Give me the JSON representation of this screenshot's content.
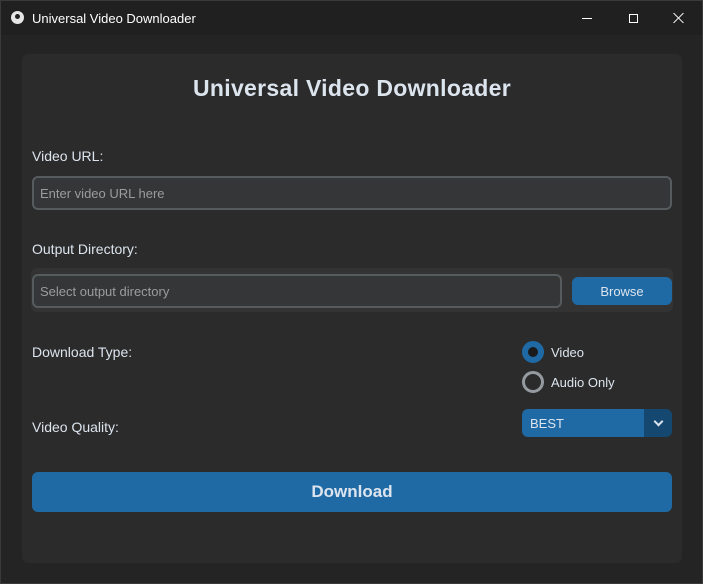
{
  "window": {
    "title": "Universal Video Downloader",
    "controls": [
      "minimize",
      "maximize",
      "close"
    ]
  },
  "main": {
    "heading": "Universal Video Downloader",
    "url": {
      "label": "Video URL:",
      "value": "",
      "placeholder": "Enter video URL here"
    },
    "output": {
      "label": "Output Directory:",
      "value": "",
      "placeholder": "Select output directory",
      "browse_label": "Browse"
    },
    "download_type": {
      "label": "Download Type:",
      "options": [
        {
          "label": "Video",
          "selected": true
        },
        {
          "label": "Audio Only",
          "selected": false
        }
      ]
    },
    "quality": {
      "label": "Video Quality:",
      "selected": "BEST"
    },
    "download_label": "Download"
  },
  "colors": {
    "accent": "#1f6aa5",
    "accent_dark": "#144870",
    "panel": "#2b2b2b",
    "background": "#242424",
    "text": "#dce4ee"
  }
}
